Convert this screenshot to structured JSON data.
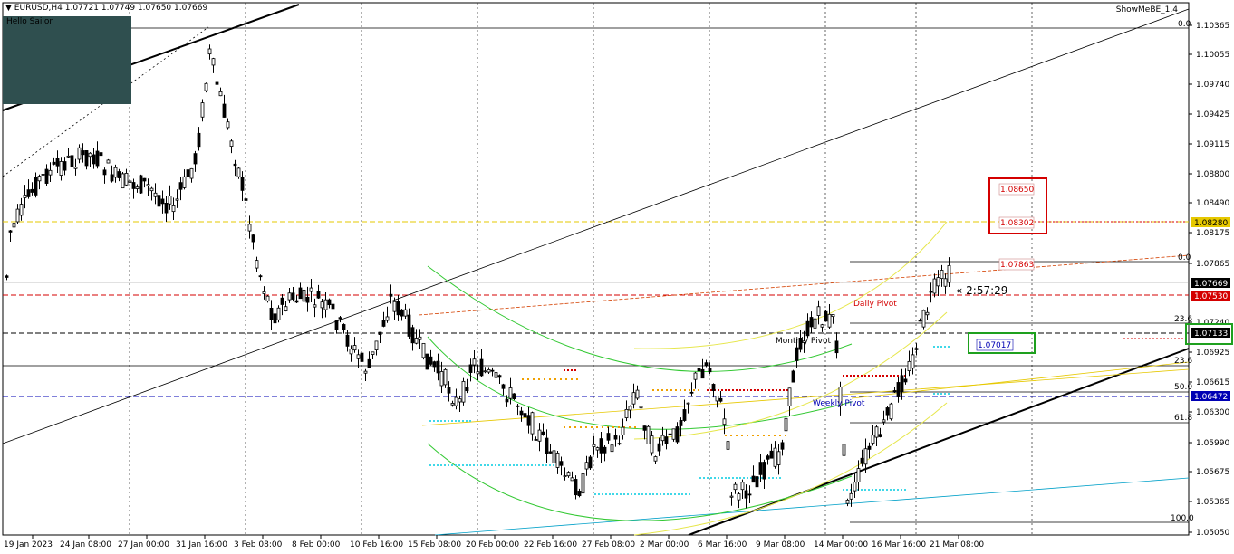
{
  "chart_header": {
    "symbol_line": "EURUSD,H4  1.07721 1.07749 1.07650 1.07669",
    "indicator": "ShowMeBE_1.4",
    "panel_text": "Hello Sailor",
    "countdown": "« 2:57:29"
  },
  "levels": {
    "fib_0_top": "0.0",
    "fib_0_mid": "0.0",
    "fib_236": "23.6",
    "fib_382": "23.6",
    "fib_50": "50.0",
    "fib_618": "61.8",
    "fib_100": "100.0"
  },
  "boxes": {
    "red_top": "1.08650",
    "red_bottom": "1.08302",
    "orange": "1.07863",
    "green": "1.07017"
  },
  "labels": {
    "daily_pivot": "Daily Pivot",
    "monthly_pivot": "Monthly Pivot",
    "weekly_pivot": "Weekly Pivot"
  },
  "price_axis": [
    "1.10365",
    "1.10055",
    "1.09740",
    "1.09425",
    "1.09115",
    "1.08800",
    "1.08490",
    "1.08175",
    "1.07865",
    "1.07240",
    "1.06925",
    "1.06615",
    "1.06300",
    "1.05990",
    "1.05675",
    "1.05365",
    "1.05050"
  ],
  "price_tags": {
    "yellow": "1.08280",
    "current": "1.07669",
    "red": "1.07530",
    "black": "1.07133",
    "blue": "1.06472"
  },
  "time_axis": [
    "19 Jan 2023",
    "24 Jan 08:00",
    "27 Jan 00:00",
    "31 Jan 16:00",
    "3 Feb 08:00",
    "8 Feb 00:00",
    "10 Feb 16:00",
    "15 Feb 08:00",
    "20 Feb 00:00",
    "22 Feb 16:00",
    "27 Feb 08:00",
    "2 Mar 00:00",
    "6 Mar 16:00",
    "9 Mar 08:00",
    "14 Mar 00:00",
    "16 Mar 16:00",
    "21 Mar 08:00"
  ],
  "colors": {
    "bull": "#000000",
    "bear": "#000000",
    "yellow_line": "#e6c800",
    "red_line": "#d40000",
    "blue_line": "#0000b4",
    "green_arc": "#32c832",
    "yellow_arc": "#e6e64b",
    "cyan_dots": "#40d8e8",
    "orange_dots": "#f0a000"
  }
}
